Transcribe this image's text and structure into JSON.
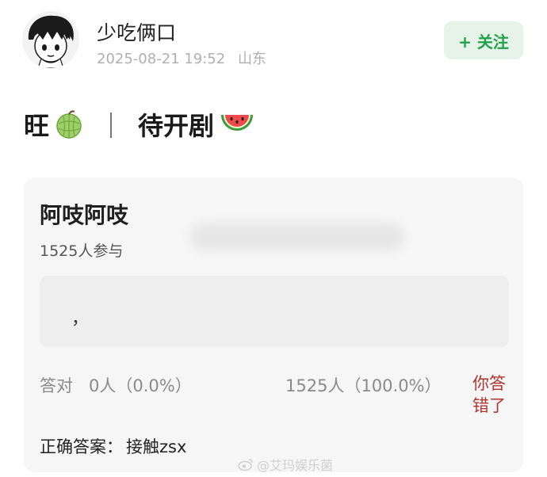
{
  "user": {
    "name": "少吃俩口",
    "timestamp": "2025-08-21 19:52",
    "location": "山东",
    "avatar_icon": "cartoon-boy-avatar"
  },
  "follow_button": {
    "label": "+ 关注"
  },
  "post": {
    "title_left": "旺",
    "title_left_emoji": "melon-icon",
    "separator": "｜",
    "title_right": "待开剧",
    "title_right_emoji": "watermelon-icon"
  },
  "quiz": {
    "title": "阿吱阿吱",
    "participants": "1525人参与",
    "answer_input": "，",
    "stats": {
      "correct_label": "答对",
      "correct_value": "0人（0.0%）",
      "wrong_value": "1525人（100.0%）",
      "wrong_badge": "你答错了"
    },
    "correct_answer_label": "正确答案：",
    "correct_answer_value": "接触zsx"
  },
  "watermark": {
    "text": "@艾玛娱乐菌"
  },
  "colors": {
    "accent_green": "#23a04a",
    "follow_bg": "#e5f3e8",
    "wrong_red": "#b2332e",
    "card_bg": "#f6f6f6"
  }
}
